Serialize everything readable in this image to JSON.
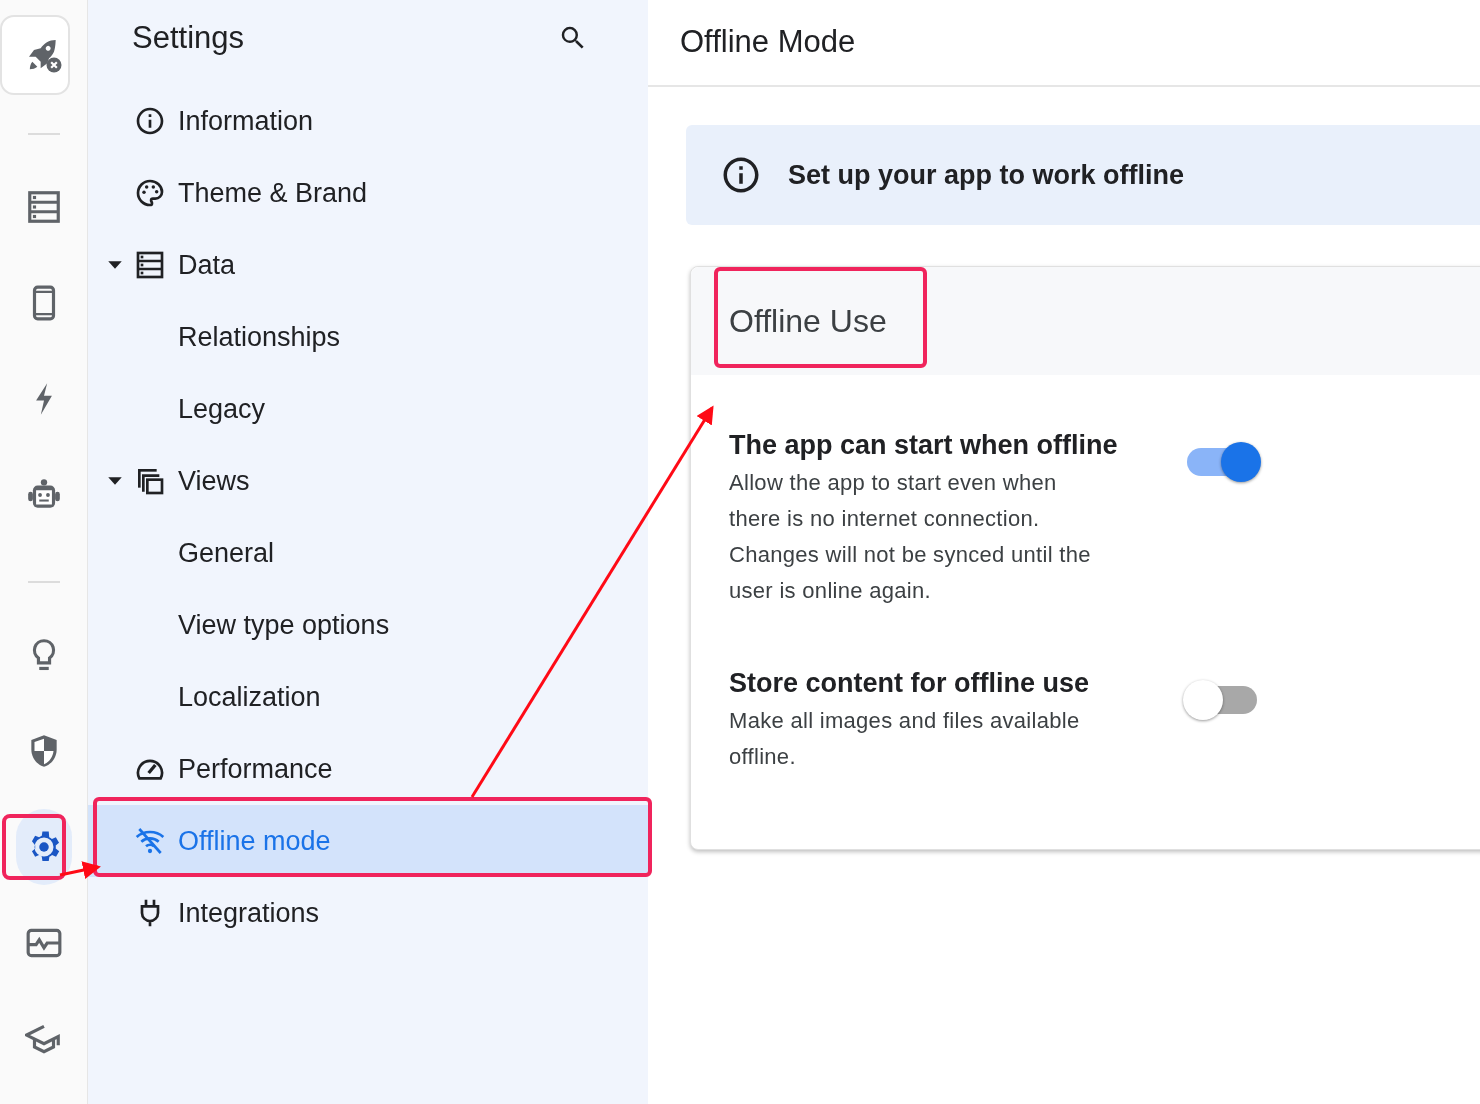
{
  "rail": [
    {
      "kind": "app"
    },
    {
      "kind": "divider"
    },
    {
      "kind": "button",
      "selected": false
    },
    {
      "kind": "button",
      "selected": false
    },
    {
      "kind": "button",
      "selected": false
    },
    {
      "kind": "button",
      "selected": false
    },
    {
      "kind": "divider"
    },
    {
      "kind": "button",
      "selected": false
    },
    {
      "kind": "button",
      "selected": false
    },
    {
      "kind": "button",
      "selected": true
    },
    {
      "kind": "button",
      "selected": false
    },
    {
      "kind": "button",
      "selected": false
    }
  ],
  "settings": {
    "title": "Settings",
    "items": [
      {
        "label": "Information",
        "selected": false
      },
      {
        "label": "Theme & Brand",
        "selected": false
      },
      {
        "label": "Data",
        "selected": false,
        "expanded": true,
        "children": [
          {
            "label": "Relationships",
            "selected": false
          },
          {
            "label": "Legacy",
            "selected": false
          }
        ]
      },
      {
        "label": "Views",
        "selected": false,
        "expanded": true,
        "children": [
          {
            "label": "General",
            "selected": false
          },
          {
            "label": "View type options",
            "selected": false
          },
          {
            "label": "Localization",
            "selected": false
          }
        ]
      },
      {
        "label": "Performance",
        "selected": false
      },
      {
        "label": "Offline mode",
        "selected": true
      },
      {
        "label": "Integrations",
        "selected": false
      }
    ]
  },
  "page": {
    "title": "Offline Mode",
    "banner": "Set up your app to work offline",
    "card": {
      "title": "Offline Use",
      "options": [
        {
          "title": "The app can start when offline",
          "description": "Allow the app to start even when there is no internet connection. Changes will not be synced until the user is online again.",
          "on": true
        },
        {
          "title": "Store content for offline use",
          "description": "Make all images and files available offline.",
          "on": false
        }
      ]
    }
  }
}
